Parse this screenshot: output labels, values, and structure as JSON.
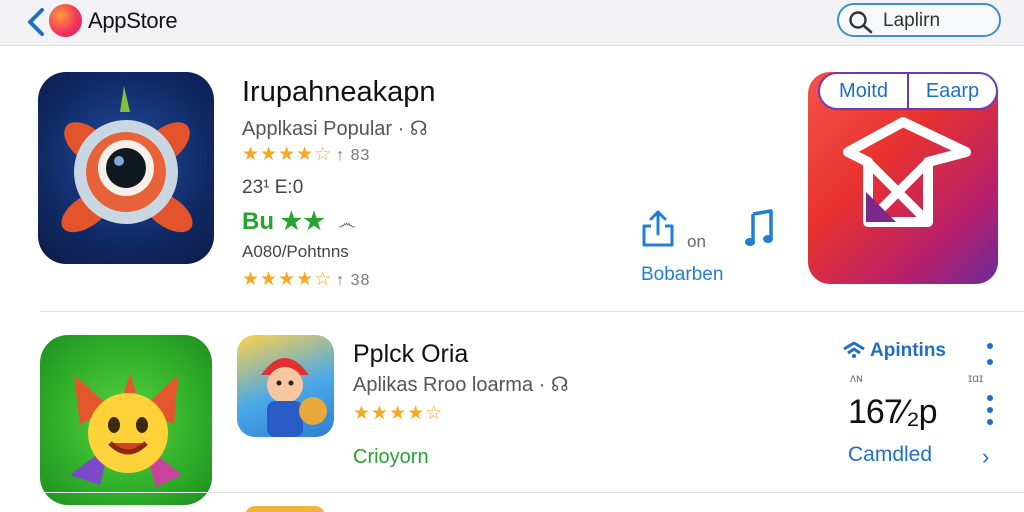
{
  "header": {
    "title": "AppStore",
    "search": {
      "value": "Laplirn",
      "placeholder": ""
    }
  },
  "featured_app": {
    "name": "Irupahneakapn",
    "subtitle": "Applkasi Popular · ☊",
    "rating_stars": "★★★★☆",
    "rating_extra": "↑ 83",
    "meta": "23¹ E:0",
    "badge_text": "Bu",
    "badge_stars": "★★",
    "badge_tag": "෴",
    "category": "A080/Pohtnns",
    "rating2_stars": "★★★★☆",
    "rating2_extra": "↑ 38",
    "share_label": "on",
    "link_label": "Bobarben",
    "segments": [
      "Moitd",
      "Eaarp"
    ]
  },
  "second_app": {
    "name": "Pplck Oria",
    "subtitle": "Aplikas Rroo loarma · ☊",
    "rating_stars": "★★★★☆",
    "status": "Crioyorn",
    "brand_label": "Apintins",
    "tiny_left": "ᴧɴ",
    "tiny_right": "ɪɑɪ",
    "price": "167⁄₂p",
    "action_label": "Camdled",
    "chevron": "›"
  },
  "colors": {
    "accent_blue": "#1f6fc8",
    "green": "#23a52e",
    "star": "#f4a921"
  },
  "icons": [
    "back-chevron-icon",
    "appstore-logo-icon",
    "search-icon",
    "share-icon",
    "music-note-icon",
    "more-vertical-icon",
    "wifi-logo-icon",
    "chevron-right-icon"
  ]
}
